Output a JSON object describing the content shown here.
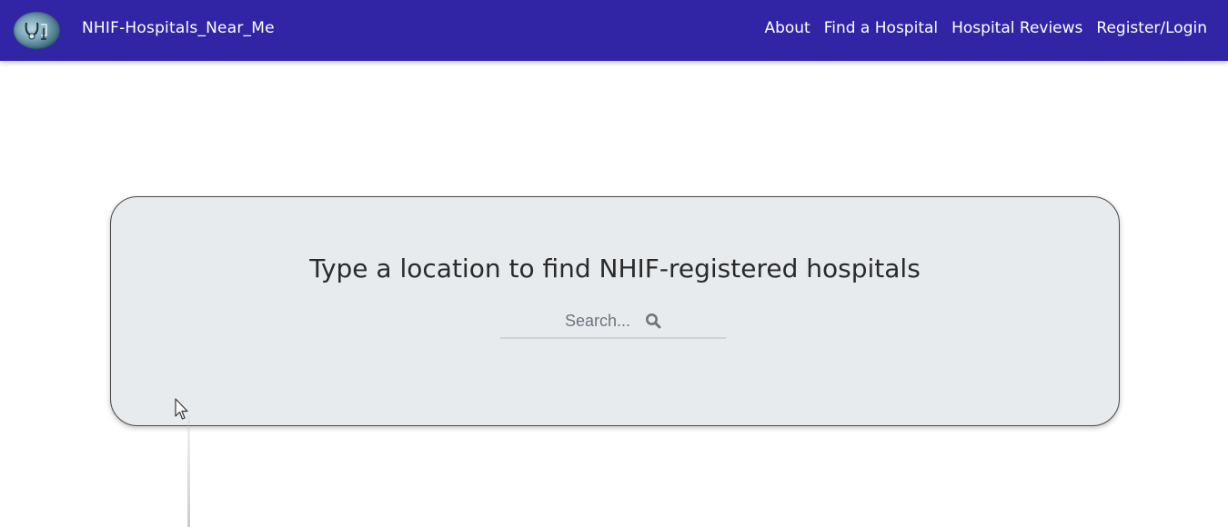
{
  "navbar": {
    "brand": "NHIF-Hospitals_Near_Me",
    "logo_icon": "stethoscope-logo-icon",
    "links": [
      {
        "label": "About"
      },
      {
        "label": "Find a Hospital"
      },
      {
        "label": "Hospital Reviews"
      },
      {
        "label": "Register/Login"
      }
    ]
  },
  "hero": {
    "title": "Type a location to find NHIF-registered hospitals",
    "search": {
      "placeholder": "Search...",
      "value": "",
      "icon": "search-icon"
    }
  },
  "colors": {
    "navbar_bg": "#3225a5",
    "hero_bg": "#e8ebee",
    "text_dark": "#2a2a2a",
    "placeholder": "#6c757d"
  }
}
